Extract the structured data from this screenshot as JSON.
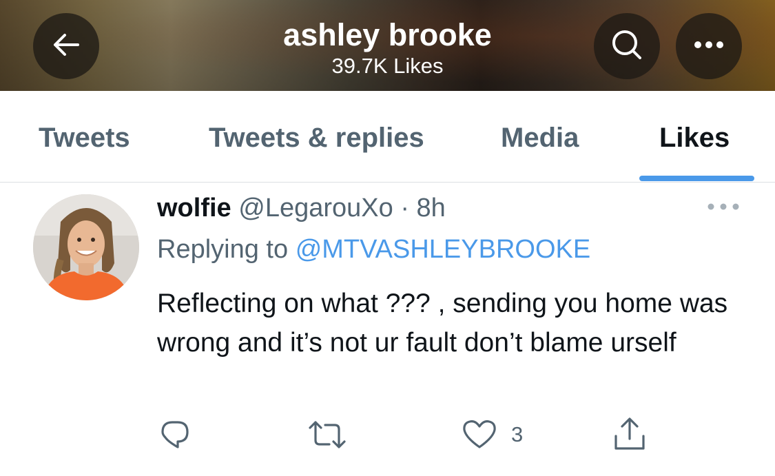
{
  "header": {
    "title": "ashley brooke",
    "subtitle": "39.7K Likes"
  },
  "icons": {
    "back": "back-arrow-icon",
    "search": "search-icon",
    "more": "more-horizontal-icon"
  },
  "tabs": [
    {
      "label": "Tweets",
      "active": false
    },
    {
      "label": "Tweets & replies",
      "active": false
    },
    {
      "label": "Media",
      "active": false
    },
    {
      "label": "Likes",
      "active": true
    }
  ],
  "tweet": {
    "name": "wolfie",
    "handle": "@LegarouXo",
    "separator": "·",
    "time": "8h",
    "replying_prefix": "Replying to",
    "replying_to": "@MTVASHLEYBROOKE",
    "text": "Reflecting on what ??? , sending you home was wrong and it’s not ur fault don’t blame urself",
    "like_count": "3"
  },
  "colors": {
    "accent": "#4a99e9",
    "secondary_text": "#536471",
    "primary_text": "#0f1419"
  }
}
